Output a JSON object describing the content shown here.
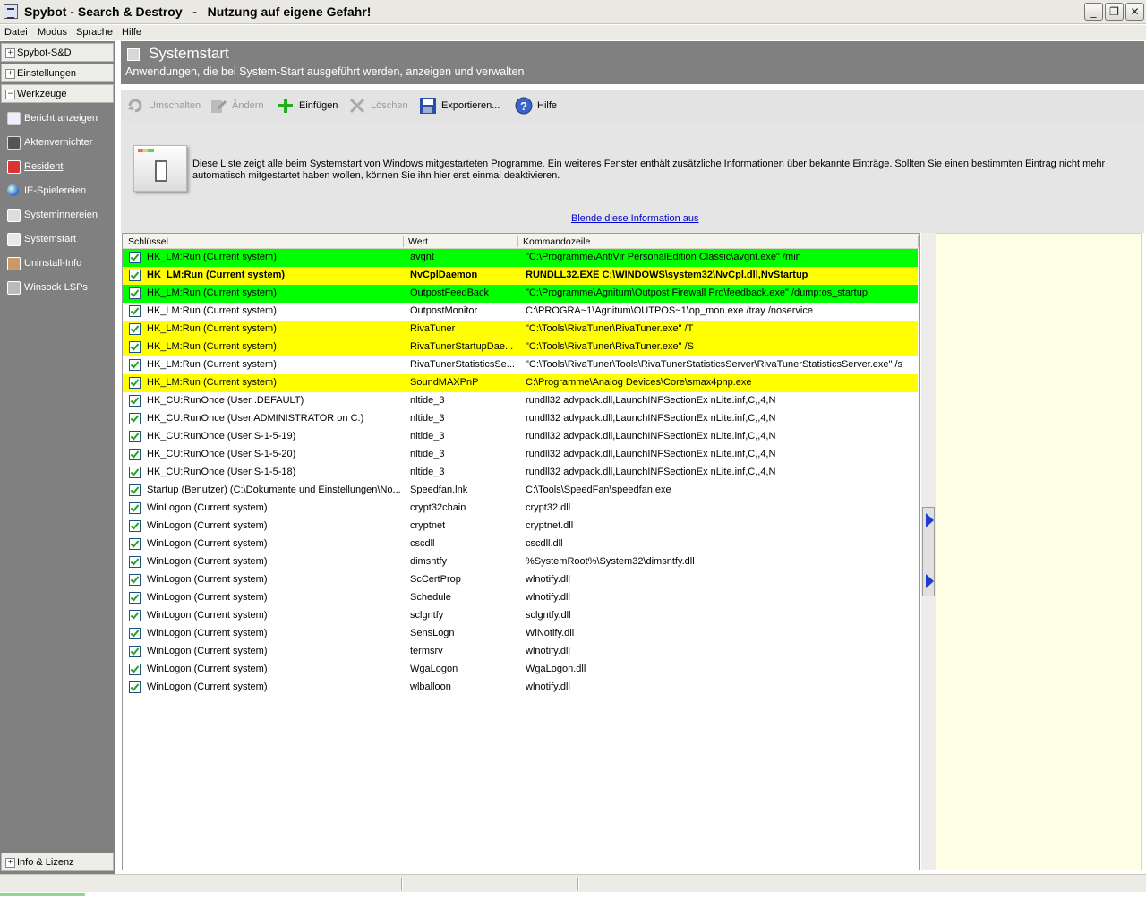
{
  "window": {
    "title": "Spybot - Search & Destroy   -   Nutzung auf eigene Gefahr!"
  },
  "menu": [
    "Datei",
    "Modus",
    "Sprache",
    "Hilfe"
  ],
  "sidebar": {
    "sections": [
      "Spybot-S&D",
      "Einstellungen",
      "Werkzeuge"
    ],
    "tools": [
      {
        "label": "Bericht anzeigen",
        "icon": "report-icon"
      },
      {
        "label": "Aktenvernichter",
        "icon": "shredder-icon"
      },
      {
        "label": "Resident",
        "icon": "shield-icon"
      },
      {
        "label": "IE-Spielereien",
        "icon": "globe-icon"
      },
      {
        "label": "Systeminnereien",
        "icon": "system-icon"
      },
      {
        "label": "Systemstart",
        "icon": "startup-icon"
      },
      {
        "label": "Uninstall-Info",
        "icon": "uninstall-icon"
      },
      {
        "label": "Winsock LSPs",
        "icon": "winsock-icon"
      }
    ],
    "bottom_section": "Info & Lizenz"
  },
  "header": {
    "title": "Systemstart",
    "subtitle": "Anwendungen, die bei System-Start ausgeführt werden, anzeigen und verwalten"
  },
  "toolbar": [
    {
      "label": "Umschalten",
      "enabled": false
    },
    {
      "label": "Ändern",
      "enabled": false
    },
    {
      "label": "Einfügen",
      "enabled": true
    },
    {
      "label": "Löschen",
      "enabled": false
    },
    {
      "label": "Exportieren...",
      "enabled": true
    },
    {
      "label": "Hilfe",
      "enabled": true
    }
  ],
  "info": {
    "text": "Diese Liste zeigt alle beim Systemstart von Windows mitgestarteten Programme. Ein weiteres Fenster enthält zusätzliche Informationen über bekannte Einträge. Sollten Sie einen bestimmten Eintrag nicht mehr automatisch mitgestartet haben wollen, können Sie ihn hier erst einmal deaktivieren.",
    "link": "Blende diese Information aus"
  },
  "table": {
    "columns": [
      "Schlüssel",
      "Wert",
      "Kommandozeile"
    ],
    "colors": {
      "green": "#00ff00",
      "yellow": "#ffff00",
      "white": "#ffffff"
    },
    "rows": [
      {
        "key": "HK_LM:Run (Current system)",
        "value": "avgnt",
        "cmd": "\"C:\\Programme\\AntiVir PersonalEdition Classic\\avgnt.exe\" /min",
        "color": "green",
        "bold": false
      },
      {
        "key": "HK_LM:Run (Current system)",
        "value": "NvCplDaemon",
        "cmd": "RUNDLL32.EXE C:\\WINDOWS\\system32\\NvCpl.dll,NvStartup",
        "color": "yellow",
        "bold": true
      },
      {
        "key": "HK_LM:Run (Current system)",
        "value": "OutpostFeedBack",
        "cmd": "\"C:\\Programme\\Agnitum\\Outpost Firewall Pro\\feedback.exe\" /dump:os_startup",
        "color": "green",
        "bold": false
      },
      {
        "key": "HK_LM:Run (Current system)",
        "value": "OutpostMonitor",
        "cmd": "C:\\PROGRA~1\\Agnitum\\OUTPOS~1\\op_mon.exe /tray /noservice",
        "color": "white",
        "bold": false
      },
      {
        "key": "HK_LM:Run (Current system)",
        "value": "RivaTuner",
        "cmd": "\"C:\\Tools\\RivaTuner\\RivaTuner.exe\" /T",
        "color": "yellow",
        "bold": false
      },
      {
        "key": "HK_LM:Run (Current system)",
        "value": "RivaTunerStartupDae...",
        "cmd": "\"C:\\Tools\\RivaTuner\\RivaTuner.exe\" /S",
        "color": "yellow",
        "bold": false
      },
      {
        "key": "HK_LM:Run (Current system)",
        "value": "RivaTunerStatisticsSe...",
        "cmd": "\"C:\\Tools\\RivaTuner\\Tools\\RivaTunerStatisticsServer\\RivaTunerStatisticsServer.exe\" /s",
        "color": "white",
        "bold": false
      },
      {
        "key": "HK_LM:Run (Current system)",
        "value": "SoundMAXPnP",
        "cmd": "C:\\Programme\\Analog Devices\\Core\\smax4pnp.exe",
        "color": "yellow",
        "bold": false
      },
      {
        "key": "HK_CU:RunOnce (User .DEFAULT)",
        "value": "nltide_3",
        "cmd": "rundll32 advpack.dll,LaunchINFSectionEx nLite.inf,C,,4,N",
        "color": "white",
        "bold": false
      },
      {
        "key": "HK_CU:RunOnce (User ADMINISTRATOR on C:)",
        "value": "nltide_3",
        "cmd": "rundll32 advpack.dll,LaunchINFSectionEx nLite.inf,C,,4,N",
        "color": "white",
        "bold": false
      },
      {
        "key": "HK_CU:RunOnce (User S-1-5-19)",
        "value": "nltide_3",
        "cmd": "rundll32 advpack.dll,LaunchINFSectionEx nLite.inf,C,,4,N",
        "color": "white",
        "bold": false
      },
      {
        "key": "HK_CU:RunOnce (User S-1-5-20)",
        "value": "nltide_3",
        "cmd": "rundll32 advpack.dll,LaunchINFSectionEx nLite.inf,C,,4,N",
        "color": "white",
        "bold": false
      },
      {
        "key": "HK_CU:RunOnce (User S-1-5-18)",
        "value": "nltide_3",
        "cmd": "rundll32 advpack.dll,LaunchINFSectionEx nLite.inf,C,,4,N",
        "color": "white",
        "bold": false
      },
      {
        "key": "Startup (Benutzer) (C:\\Dokumente und Einstellungen\\No...",
        "value": "Speedfan.lnk",
        "cmd": "C:\\Tools\\SpeedFan\\speedfan.exe",
        "color": "white",
        "bold": false
      },
      {
        "key": "WinLogon (Current system)",
        "value": "crypt32chain",
        "cmd": "crypt32.dll",
        "color": "white",
        "bold": false
      },
      {
        "key": "WinLogon (Current system)",
        "value": "cryptnet",
        "cmd": "cryptnet.dll",
        "color": "white",
        "bold": false
      },
      {
        "key": "WinLogon (Current system)",
        "value": "cscdll",
        "cmd": "cscdll.dll",
        "color": "white",
        "bold": false
      },
      {
        "key": "WinLogon (Current system)",
        "value": "dimsntfy",
        "cmd": "%SystemRoot%\\System32\\dimsntfy.dll",
        "color": "white",
        "bold": false
      },
      {
        "key": "WinLogon (Current system)",
        "value": "ScCertProp",
        "cmd": "wlnotify.dll",
        "color": "white",
        "bold": false
      },
      {
        "key": "WinLogon (Current system)",
        "value": "Schedule",
        "cmd": "wlnotify.dll",
        "color": "white",
        "bold": false
      },
      {
        "key": "WinLogon (Current system)",
        "value": "sclgntfy",
        "cmd": "sclgntfy.dll",
        "color": "white",
        "bold": false
      },
      {
        "key": "WinLogon (Current system)",
        "value": "SensLogn",
        "cmd": "WlNotify.dll",
        "color": "white",
        "bold": false
      },
      {
        "key": "WinLogon (Current system)",
        "value": "termsrv",
        "cmd": "wlnotify.dll",
        "color": "white",
        "bold": false
      },
      {
        "key": "WinLogon (Current system)",
        "value": "WgaLogon",
        "cmd": "WgaLogon.dll",
        "color": "white",
        "bold": false
      },
      {
        "key": "WinLogon (Current system)",
        "value": "wlballoon",
        "cmd": "wlnotify.dll",
        "color": "white",
        "bold": false
      }
    ]
  }
}
